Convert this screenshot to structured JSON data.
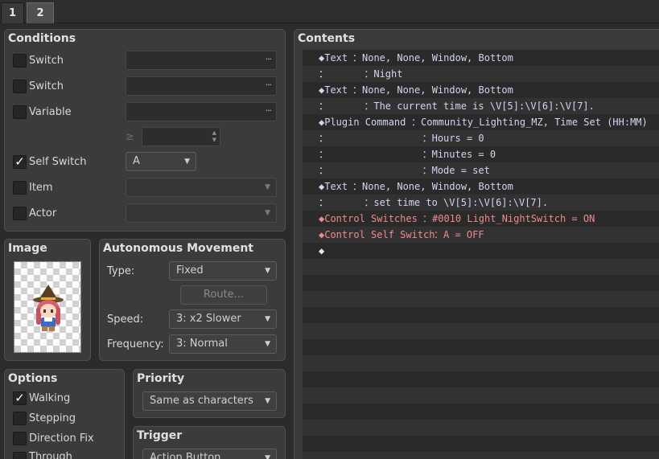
{
  "tabs": [
    "1",
    "2"
  ],
  "conditions": {
    "title": "Conditions",
    "switch1_label": "Switch",
    "switch2_label": "Switch",
    "variable_label": "Variable",
    "gte_symbol": "≥",
    "self_switch_label": "Self Switch",
    "self_switch_value": "A",
    "self_switch_checked": true,
    "item_label": "Item",
    "actor_label": "Actor",
    "dots": "···"
  },
  "image": {
    "title": "Image"
  },
  "autonomous": {
    "title": "Autonomous Movement",
    "type_label": "Type:",
    "type_value": "Fixed",
    "route_label": "Route...",
    "speed_label": "Speed:",
    "speed_value": "3: x2 Slower",
    "frequency_label": "Frequency:",
    "frequency_value": "3: Normal"
  },
  "options": {
    "title": "Options",
    "walking_label": "Walking",
    "walking_checked": true,
    "stepping_label": "Stepping",
    "direction_fix_label": "Direction Fix",
    "through_label": "Through"
  },
  "priority": {
    "title": "Priority",
    "value": "Same as characters"
  },
  "trigger": {
    "title": "Trigger",
    "value": "Action Button"
  },
  "contents": {
    "title": "Contents",
    "rows": [
      {
        "pre": "◆Text",
        "rest": "：None, None, Window, Bottom",
        "color": "blue"
      },
      {
        "pre": "：",
        "rest": "      ：Night",
        "color": "blue"
      },
      {
        "pre": "◆Text",
        "rest": "：None, None, Window, Bottom",
        "color": "blue"
      },
      {
        "pre": "：",
        "rest": "      ：The current time is \\V[5]:\\V[6]:\\V[7].",
        "color": "blue"
      },
      {
        "pre": "◆Plugin Command",
        "rest": "：Community_Lighting_MZ, Time Set (HH:MM)",
        "color": "blue"
      },
      {
        "pre": "：",
        "rest": "                ：Hours = 0",
        "color": "blue"
      },
      {
        "pre": "：",
        "rest": "                ：Minutes = 0",
        "color": "blue"
      },
      {
        "pre": "：",
        "rest": "                ：Mode = set",
        "color": "blue"
      },
      {
        "pre": "◆Text",
        "rest": "：None, None, Window, Bottom",
        "color": "blue"
      },
      {
        "pre": "：",
        "rest": "      ：set time to \\V[5]:\\V[6]:\\V[7].",
        "color": "blue"
      },
      {
        "pre": "◆Control Switches",
        "rest": "：#0010 Light_NightSwitch = ON",
        "color": "red"
      },
      {
        "pre": "◆Control Self Switch",
        "rest": "：A = OFF",
        "color": "red"
      },
      {
        "pre": "◆",
        "rest": "",
        "color": "white"
      }
    ]
  }
}
